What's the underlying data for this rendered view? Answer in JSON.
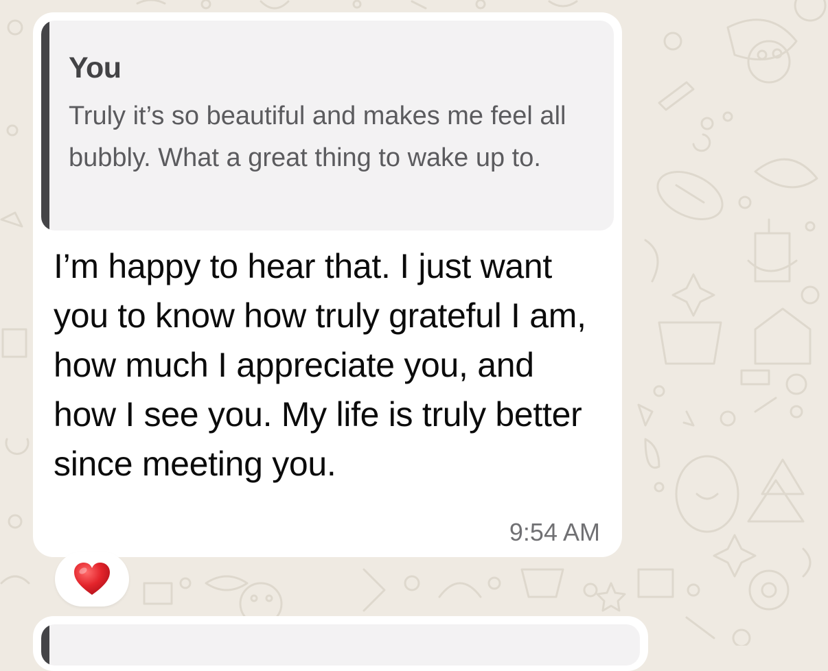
{
  "chat": {
    "message": {
      "quoted": {
        "author": "You",
        "text": "Truly it’s so beautiful and makes me feel all bubbly. What a great thing to wake up to."
      },
      "text": "I’m happy to hear that. I just want you to know how truly grateful I am, how much I appreciate you, and how I see you. My life is truly better since meeting you.",
      "time": "9:54 AM",
      "reaction": {
        "emoji": "❤️",
        "icon": "red-heart-icon"
      }
    }
  },
  "colors": {
    "background": "#efeae2",
    "bubble": "#ffffff",
    "quote_background": "#f3f2f3",
    "quote_bar": "#444447",
    "heart": "#e3242b"
  }
}
